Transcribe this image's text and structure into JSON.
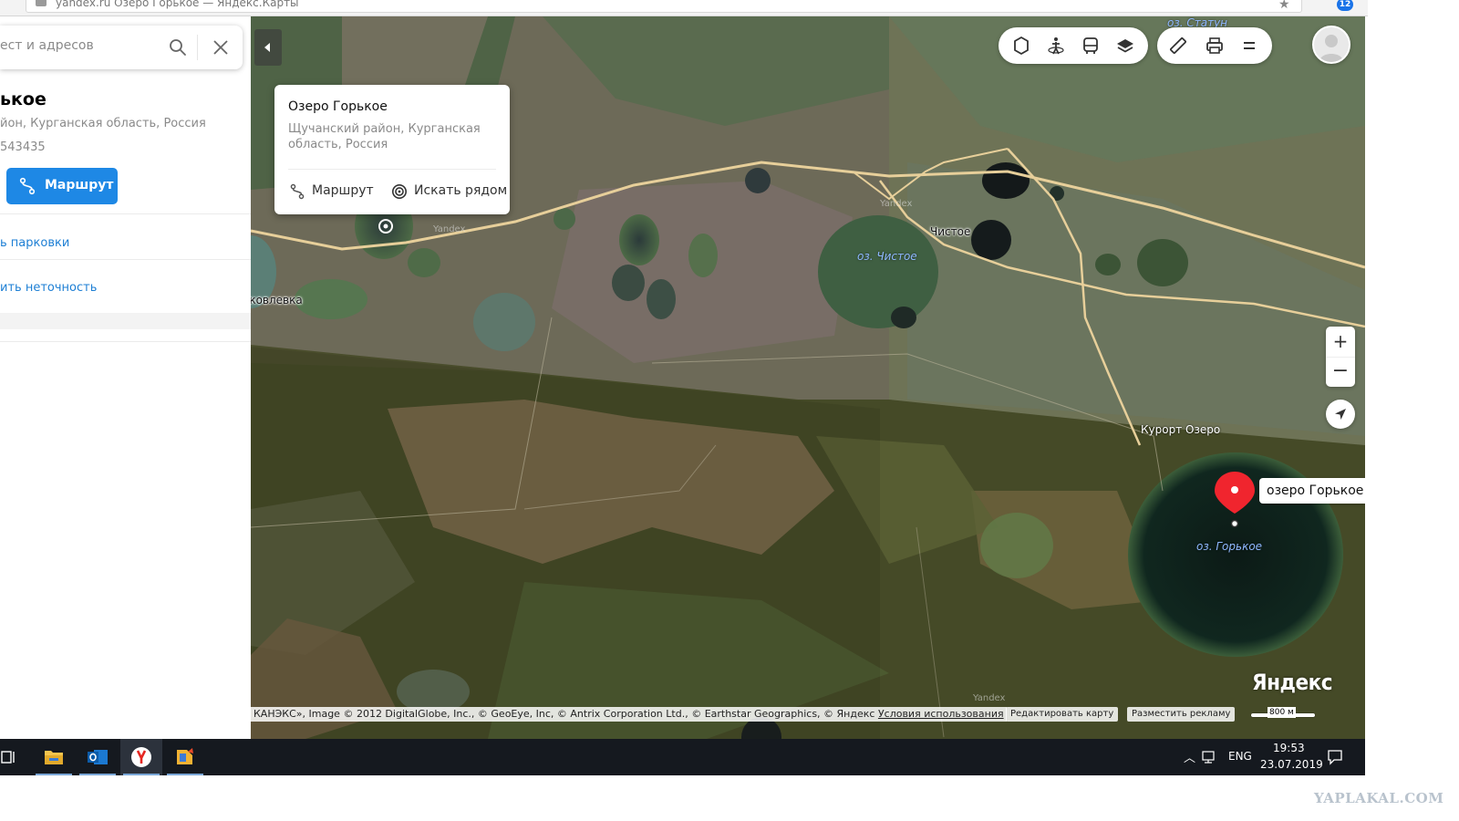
{
  "browser": {
    "url_text": "yandex.ru   Озеро Горькое — Яндекс.Карты",
    "extension_badge": "12"
  },
  "search": {
    "value": "ест и адресов"
  },
  "place": {
    "title": "ькое",
    "address": "йон, Курганская область, Россия",
    "coords": "543435",
    "route_label": "Маршрут",
    "parking_link": "ь парковки",
    "report_link": "ить неточность"
  },
  "popup": {
    "title": "Озеро Горькое",
    "address": "Щучанский район, Курганская область, Россия",
    "route_label": "Маршрут",
    "nearby_label": "Искать рядом"
  },
  "map": {
    "labels": {
      "statun": "оз. Статун",
      "chistoe_village": "Чистое",
      "chistoe_lake": "оз. Чистое",
      "yakovlevka": "Яковлевка",
      "kurort": "Курорт Озеро",
      "gorkoe_lake": "оз. Горькое"
    },
    "watermark": "Yandex",
    "pin_label": "озеро Горькое",
    "logo": "Яндекс",
    "copyright": "КАНЭКС», Image © 2012 DigitalGlobe, Inc., © GeoEye, Inc, © Antrix Corporation Ltd., © Earthstar Geographics, © Яндекс",
    "terms_link": "Условия использования",
    "edit_map": "Редактировать карту",
    "advertise": "Разместить рекламу",
    "scale": "800 м",
    "zoom_in": "+",
    "zoom_out": "−"
  },
  "icons": {
    "map_controls": [
      "traffic-icon",
      "panorama-icon",
      "transit-icon",
      "layers-icon"
    ],
    "tools": [
      "ruler-icon",
      "print-icon",
      "menu-icon"
    ]
  },
  "taskbar": {
    "lang": "ENG",
    "time": "19:53",
    "date": "23.07.2019"
  },
  "site_watermark": "YAPLAKAL.COM",
  "colors": {
    "accent_blue": "#1e88e5",
    "link_blue": "#1e7fd4",
    "pin_red": "#f0252e",
    "road": "#e7cf9a",
    "taskbar": "#15191f"
  }
}
